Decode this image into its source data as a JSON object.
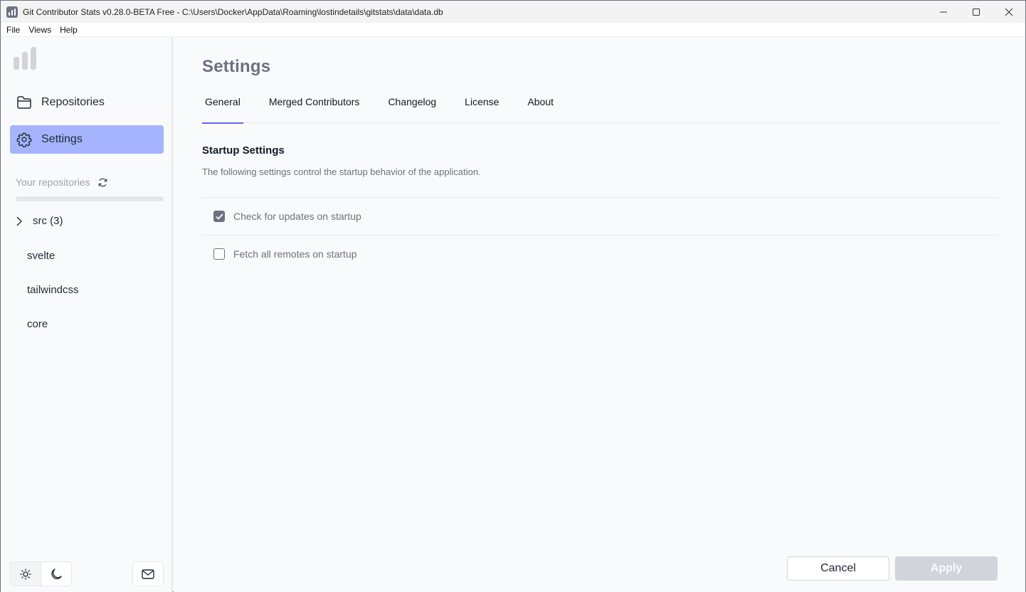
{
  "window": {
    "title": "Git Contributor Stats v0.28.0-BETA Free - C:\\Users\\Docker\\AppData\\Roaming\\lostindetails\\gitstats\\data\\data.db",
    "controls": {
      "minimize": "—",
      "maximize": "☐",
      "close": "✕"
    }
  },
  "menu": [
    "File",
    "Views",
    "Help"
  ],
  "sidebar": {
    "nav": [
      {
        "label": "Repositories",
        "icon": "folder-icon",
        "active": false
      },
      {
        "label": "Settings",
        "icon": "gear-icon",
        "active": true
      }
    ],
    "repos_header": "Your repositories",
    "repos_progress": 0,
    "repo_group": {
      "label": "src (3)",
      "expanded": false
    },
    "repos": [
      "svelte",
      "tailwindcss",
      "core"
    ]
  },
  "main": {
    "title": "Settings",
    "tabs": [
      {
        "label": "General",
        "active": true
      },
      {
        "label": "Merged Contributors",
        "active": false
      },
      {
        "label": "Changelog",
        "active": false
      },
      {
        "label": "License",
        "active": false
      },
      {
        "label": "About",
        "active": false
      }
    ],
    "section": {
      "title": "Startup Settings",
      "description": "The following settings control the startup behavior of the application."
    },
    "settings": [
      {
        "label": "Check for updates on startup",
        "checked": true
      },
      {
        "label": "Fetch all remotes on startup",
        "checked": false
      }
    ],
    "buttons": {
      "cancel": "Cancel",
      "apply": "Apply"
    }
  }
}
